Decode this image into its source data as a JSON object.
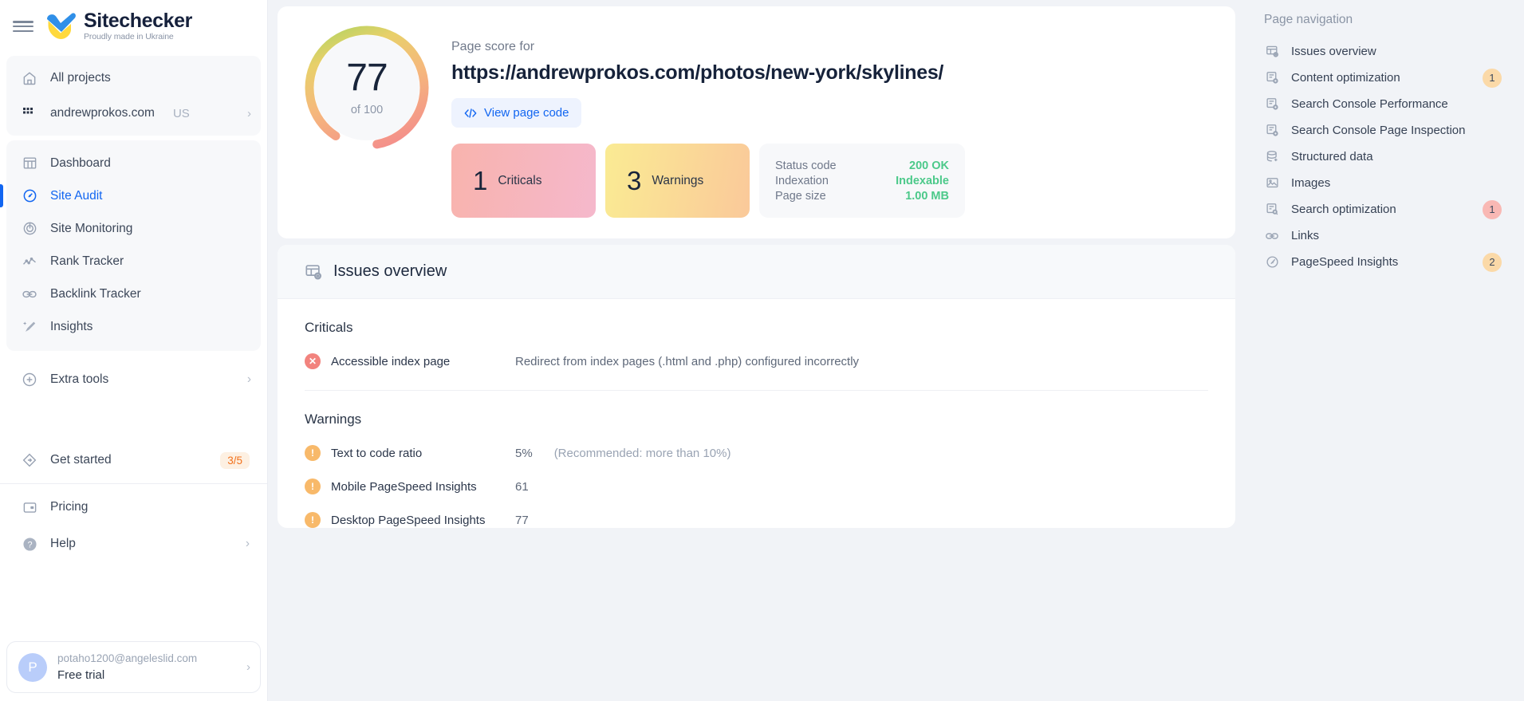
{
  "brand": {
    "name": "Sitechecker",
    "tagline": "Proudly made in Ukraine"
  },
  "sidebar": {
    "all_projects": "All projects",
    "project": {
      "name": "andrewprokos.com",
      "country": "US"
    },
    "nav": [
      {
        "label": "Dashboard",
        "icon": "dashboard-icon",
        "active": false
      },
      {
        "label": "Site Audit",
        "icon": "site-audit-icon",
        "active": true
      },
      {
        "label": "Site Monitoring",
        "icon": "site-monitoring-icon",
        "active": false
      },
      {
        "label": "Rank Tracker",
        "icon": "rank-tracker-icon",
        "active": false
      },
      {
        "label": "Backlink Tracker",
        "icon": "backlink-tracker-icon",
        "active": false
      },
      {
        "label": "Insights",
        "icon": "insights-icon",
        "active": false
      }
    ],
    "extra_tools": "Extra tools",
    "get_started": {
      "label": "Get started",
      "badge": "3/5"
    },
    "pricing": "Pricing",
    "help": "Help",
    "user": {
      "email": "potaho1200@angeleslid.com",
      "plan": "Free trial",
      "initial": "P"
    }
  },
  "page_score": {
    "label": "Page score for",
    "url": "https://andrewprokos.com/photos/new-york/skylines/",
    "score": "77",
    "of": "of 100",
    "view_code_button": "View page code"
  },
  "stats": {
    "criticals": {
      "count": "1",
      "label": "Criticals"
    },
    "warnings": {
      "count": "3",
      "label": "Warnings"
    },
    "status": [
      {
        "key": "Status code",
        "value": "200 OK"
      },
      {
        "key": "Indexation",
        "value": "Indexable"
      },
      {
        "key": "Page size",
        "value": "1.00 MB"
      }
    ]
  },
  "issues": {
    "title": "Issues overview",
    "criticals_title": "Criticals",
    "criticals": [
      {
        "name": "Accessible index page",
        "value": "Redirect from index pages (.html and .php) configured incorrectly",
        "hint": ""
      }
    ],
    "warnings_title": "Warnings",
    "warnings": [
      {
        "name": "Text to code ratio",
        "value": "5%",
        "hint": "(Recommended: more than 10%)"
      },
      {
        "name": "Mobile PageSpeed Insights",
        "value": "61",
        "hint": ""
      },
      {
        "name": "Desktop PageSpeed Insights",
        "value": "77",
        "hint": ""
      }
    ]
  },
  "page_navigation": {
    "title": "Page navigation",
    "items": [
      {
        "label": "Issues overview",
        "icon": "issues-overview-icon",
        "badge": "",
        "badge_type": ""
      },
      {
        "label": "Content optimization",
        "icon": "content-optimization-icon",
        "badge": "1",
        "badge_type": "w"
      },
      {
        "label": "Search Console Performance",
        "icon": "search-console-performance-icon",
        "badge": "",
        "badge_type": ""
      },
      {
        "label": "Search Console Page Inspection",
        "icon": "search-console-inspection-icon",
        "badge": "",
        "badge_type": ""
      },
      {
        "label": "Structured data",
        "icon": "structured-data-icon",
        "badge": "",
        "badge_type": ""
      },
      {
        "label": "Images",
        "icon": "images-icon",
        "badge": "",
        "badge_type": ""
      },
      {
        "label": "Search optimization",
        "icon": "search-optimization-icon",
        "badge": "1",
        "badge_type": "c"
      },
      {
        "label": "Links",
        "icon": "links-icon",
        "badge": "",
        "badge_type": ""
      },
      {
        "label": "PageSpeed Insights",
        "icon": "pagespeed-insights-icon",
        "badge": "2",
        "badge_type": "w"
      }
    ]
  },
  "colors": {
    "accent": "#1266f1",
    "success": "#4cc98a",
    "warning": "#f2711c",
    "critical": "#f2837e"
  }
}
